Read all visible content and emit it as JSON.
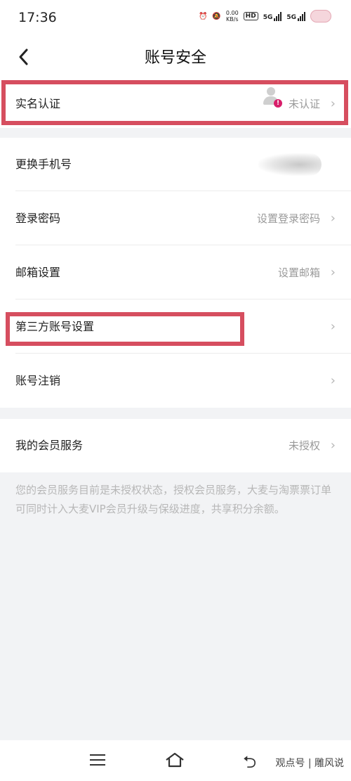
{
  "status_bar": {
    "time": "17:36",
    "speed_value": "0.00",
    "speed_unit": "KB/s",
    "hd_badge": "HD",
    "network_1": "5G",
    "network_2": "5G"
  },
  "nav": {
    "back_icon": "chevron-left-icon",
    "title": "账号安全"
  },
  "sections": {
    "identity": {
      "label": "实名认证",
      "value": "未认证"
    },
    "account": [
      {
        "label": "更换手机号",
        "value": ""
      },
      {
        "label": "登录密码",
        "value": "设置登录密码"
      },
      {
        "label": "邮箱设置",
        "value": "设置邮箱"
      },
      {
        "label": "第三方账号设置",
        "value": ""
      },
      {
        "label": "账号注销",
        "value": ""
      }
    ],
    "membership": {
      "label": "我的会员服务",
      "value": "未授权"
    }
  },
  "membership_note": "您的会员服务目前是未授权状态，授权会员服务，大麦与淘票票订单可同时计入大麦VIP会员升级与保级进度，共享积分余额。",
  "chevron": "›",
  "watermark": "观点号 | 雕风说",
  "colors": {
    "highlight": "#d64e5f",
    "background": "#f2f3f5",
    "alert_badge": "#d81e6a"
  }
}
